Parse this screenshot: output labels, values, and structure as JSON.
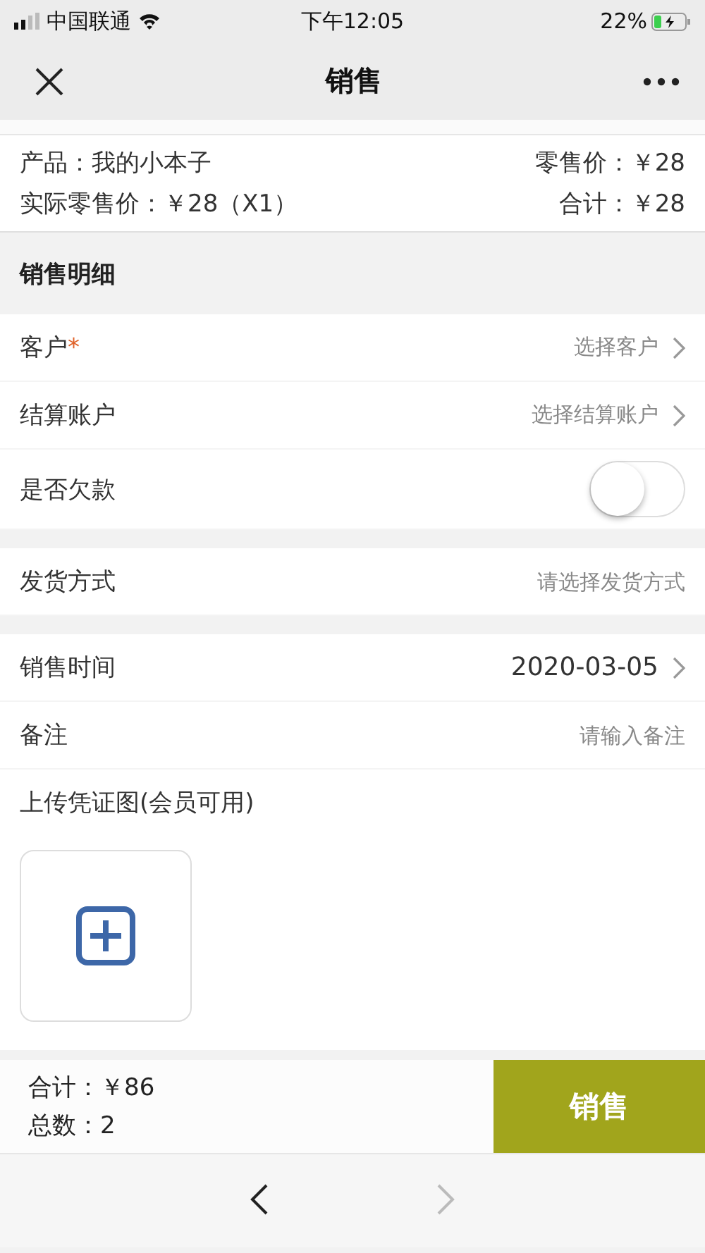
{
  "status_bar": {
    "carrier": "中国联通",
    "time": "下午12:05",
    "battery": "22%"
  },
  "nav": {
    "title": "销售"
  },
  "product": {
    "name": "产品：我的小本子",
    "retail_price": "零售价：￥28",
    "actual_price": "实际零售价：￥28（X1）",
    "subtotal": "合计：￥28"
  },
  "section_title": "销售明细",
  "groups": [
    [
      {
        "kind": "select",
        "label": "客户",
        "required_mark": "*",
        "placeholder": "选择客户"
      },
      {
        "kind": "select",
        "label": "结算账户",
        "placeholder": "选择结算账户"
      },
      {
        "kind": "toggle",
        "label": "是否欠款",
        "on": false
      }
    ],
    [
      {
        "kind": "input",
        "label": "发货方式",
        "placeholder": "请选择发货方式"
      }
    ],
    [
      {
        "kind": "select",
        "label": "销售时间",
        "value": "2020-03-05"
      },
      {
        "kind": "input",
        "label": "备注",
        "placeholder": "请输入备注"
      },
      {
        "kind": "upload",
        "label": "上传凭证图(会员可用)"
      }
    ]
  ],
  "footer": {
    "total": "合计：￥86",
    "count": "总数：2",
    "submit": "销售"
  },
  "browser_nav": {
    "back_disabled": false,
    "forward_disabled": true
  }
}
